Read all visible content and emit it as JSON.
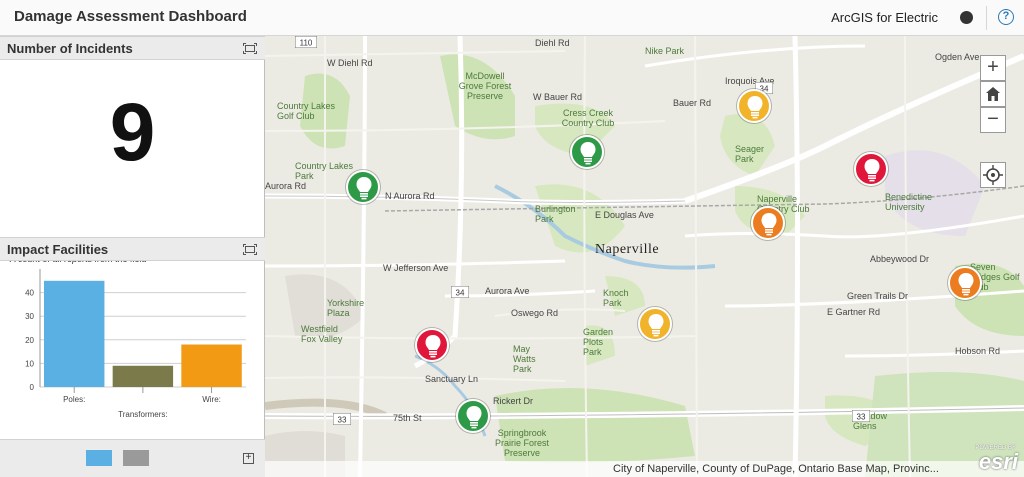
{
  "header": {
    "title": "Damage Assessment Dashboard",
    "product": "ArcGIS for Electric",
    "help_glyph": "?"
  },
  "incidents_panel": {
    "title": "Number of Incidents",
    "count": "9",
    "description": "A count of all reports from the field"
  },
  "facilities_panel": {
    "title": "Impact Facilities",
    "expand_glyph": "+"
  },
  "chart_data": {
    "type": "bar",
    "categories": [
      "Poles:",
      "Transformers:",
      "Wire:"
    ],
    "values": [
      45,
      9,
      18
    ],
    "colors": [
      "#5ab0e2",
      "#7a7a4a",
      "#f29a14"
    ],
    "yticks": [
      0,
      10,
      20,
      30,
      40
    ],
    "ylim": [
      0,
      50
    ],
    "grid": true
  },
  "legend": {
    "colors": [
      "#5ab0e2",
      "#9a9a9a"
    ]
  },
  "map": {
    "zoom_in": "+",
    "zoom_out": "−",
    "attribution": "City of Naperville, County of DuPage, Ontario Base Map, Provinc...",
    "esri_logo": "esri",
    "powered_by": "POWERED BY",
    "pin_colors": {
      "green": "#2e9a48",
      "yellow": "#f0b32a",
      "orange": "#eb7c1f",
      "red": "#e0173a"
    },
    "labels": [
      {
        "text": "W Diehl Rd"
      },
      {
        "text": "Diehl Rd"
      },
      {
        "text": "Nike Park"
      },
      {
        "text": "Country Lakes Golf Club"
      },
      {
        "text": "McDowell Grove Forest Preserve"
      },
      {
        "text": "W Bauer Rd"
      },
      {
        "text": "Bauer Rd"
      },
      {
        "text": "Iroquois Ave"
      },
      {
        "text": "Cress Creek Country Club"
      },
      {
        "text": "Seager Park"
      },
      {
        "text": "Country Lakes Park"
      },
      {
        "text": "N Aurora Rd"
      },
      {
        "text": "Aurora Rd"
      },
      {
        "text": "Burlington Park"
      },
      {
        "text": "E Douglas Ave"
      },
      {
        "text": "Naperville Country Club"
      },
      {
        "text": "Benedictine University"
      },
      {
        "text": "Naperville"
      },
      {
        "text": "W Jefferson Ave"
      },
      {
        "text": "Aurora Ave"
      },
      {
        "text": "Yorkshire Plaza"
      },
      {
        "text": "Westfield Fox Valley"
      },
      {
        "text": "Knoch Park"
      },
      {
        "text": "Garden Plots Park"
      },
      {
        "text": "May Watts Park"
      },
      {
        "text": "Green Trails Dr"
      },
      {
        "text": "E Gartner Rd"
      },
      {
        "text": "Hobson Rd"
      },
      {
        "text": "Sanctuary Ln"
      },
      {
        "text": "Rickert Dr"
      },
      {
        "text": "75th St"
      },
      {
        "text": "Springbrook Prairie Forest Preserve"
      },
      {
        "text": "Meadow Glens"
      },
      {
        "text": "Seven Bridges Golf Club"
      },
      {
        "text": "Abbeywood Dr"
      },
      {
        "text": "Ogden Ave"
      },
      {
        "text": "Oswego Rd"
      }
    ],
    "shields": [
      "110",
      "34",
      "34",
      "33",
      "33"
    ]
  }
}
